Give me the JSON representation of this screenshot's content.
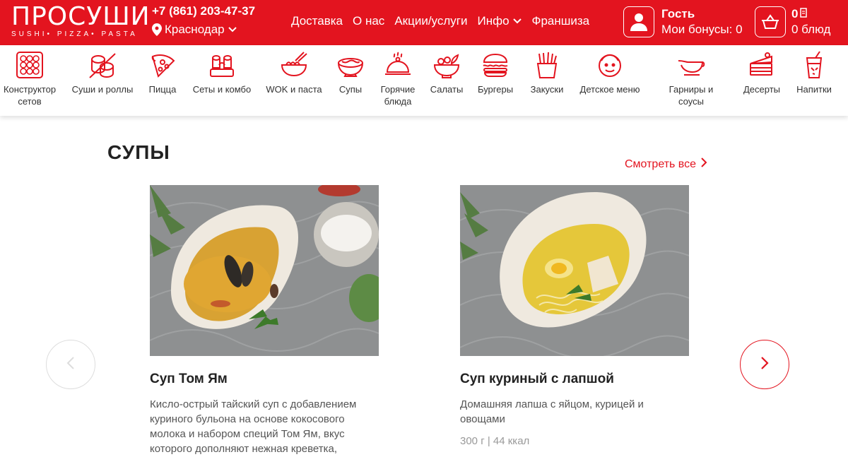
{
  "header": {
    "logo_main": "ПРОСУШИ",
    "logo_sub": "SUSHI• PIZZA• PASTA",
    "phone": "+7 (861) 203-47-37",
    "city": "Краснодар",
    "nav": [
      "Доставка",
      "О нас",
      "Акции/услуги",
      "Инфо",
      "Франшиза"
    ],
    "user_name": "Гость",
    "user_bonus": "Мои бонусы: 0",
    "cart_sum": "0",
    "cart_count": "0 блюд"
  },
  "categories": [
    {
      "label": "Конструктор сетов",
      "icon": "set-builder-icon"
    },
    {
      "label": "Суши и роллы",
      "icon": "sushi-icon"
    },
    {
      "label": "Пицца",
      "icon": "pizza-icon"
    },
    {
      "label": "Сеты и комбо",
      "icon": "sets-icon"
    },
    {
      "label": "WOK и паста",
      "icon": "wok-icon"
    },
    {
      "label": "Супы",
      "icon": "soup-icon"
    },
    {
      "label": "Горячие блюда",
      "icon": "cloche-icon"
    },
    {
      "label": "Салаты",
      "icon": "salad-icon"
    },
    {
      "label": "Бургеры",
      "icon": "burger-icon"
    },
    {
      "label": "Закуски",
      "icon": "fries-icon"
    },
    {
      "label": "Детское меню",
      "icon": "kid-icon"
    },
    {
      "label": "Гарниры и соусы",
      "icon": "sauce-boat-icon"
    },
    {
      "label": "Десерты",
      "icon": "cake-icon"
    },
    {
      "label": "Напитки",
      "icon": "drink-icon"
    }
  ],
  "section": {
    "title": "СУПЫ",
    "see_all": "Смотреть все"
  },
  "products": [
    {
      "title": "Суп Том Ям",
      "desc": "Кисло-острый тайский суп с добавлением куриного бульона на основе кокосового молока и набором специй Том Ям, вкус которого дополняют нежная креветка,",
      "meta": ""
    },
    {
      "title": "Суп куриный с лапшой",
      "desc": "Домашняя лапша с яйцом, курицей и овощами",
      "meta": "300 г | 44 ккал"
    }
  ],
  "colors": {
    "brand": "#e3141f"
  }
}
